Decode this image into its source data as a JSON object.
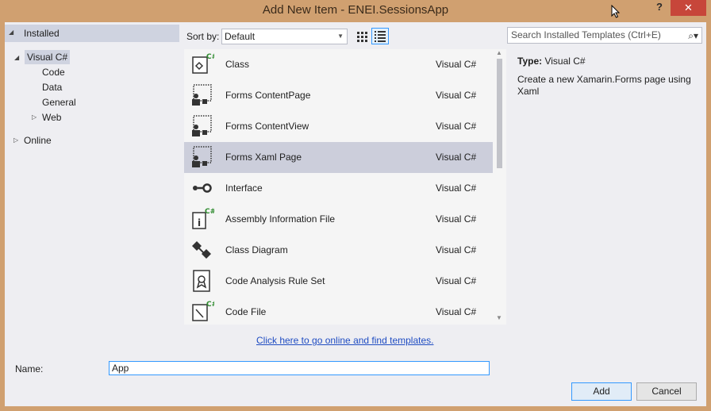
{
  "window": {
    "title": "Add New Item - ENEI.SessionsApp",
    "help_label": "?",
    "close_label": "✕"
  },
  "tree": {
    "installed": "Installed",
    "visual_csharp": "Visual C#",
    "children": [
      "Code",
      "Data",
      "General",
      "Web"
    ],
    "online": "Online"
  },
  "toolbar": {
    "sort_label": "Sort by:",
    "sort_value": "Default",
    "search_placeholder": "Search Installed Templates (Ctrl+E)"
  },
  "templates": [
    {
      "name": "Class",
      "lang": "Visual C#",
      "icon": "class-icon"
    },
    {
      "name": "Forms ContentPage",
      "lang": "Visual C#",
      "icon": "forms-page-icon"
    },
    {
      "name": "Forms ContentView",
      "lang": "Visual C#",
      "icon": "forms-page-icon"
    },
    {
      "name": "Forms Xaml Page",
      "lang": "Visual C#",
      "icon": "forms-page-icon",
      "selected": true
    },
    {
      "name": "Interface",
      "lang": "Visual C#",
      "icon": "interface-icon"
    },
    {
      "name": "Assembly Information File",
      "lang": "Visual C#",
      "icon": "assembly-info-icon"
    },
    {
      "name": "Class Diagram",
      "lang": "Visual C#",
      "icon": "class-diagram-icon"
    },
    {
      "name": "Code Analysis Rule Set",
      "lang": "Visual C#",
      "icon": "rule-set-icon"
    },
    {
      "name": "Code File",
      "lang": "Visual C#",
      "icon": "code-file-icon"
    }
  ],
  "details": {
    "type_label": "Type:",
    "type_value": "Visual C#",
    "description": "Create a new Xamarin.Forms page using Xaml"
  },
  "online_link": "Click here to go online and find templates.",
  "name_field": {
    "label": "Name:",
    "value": "App"
  },
  "buttons": {
    "add": "Add",
    "cancel": "Cancel"
  },
  "colors": {
    "frame": "#d0a070",
    "selection": "#cccedb",
    "accent": "#3399ff",
    "close": "#c7463a"
  }
}
